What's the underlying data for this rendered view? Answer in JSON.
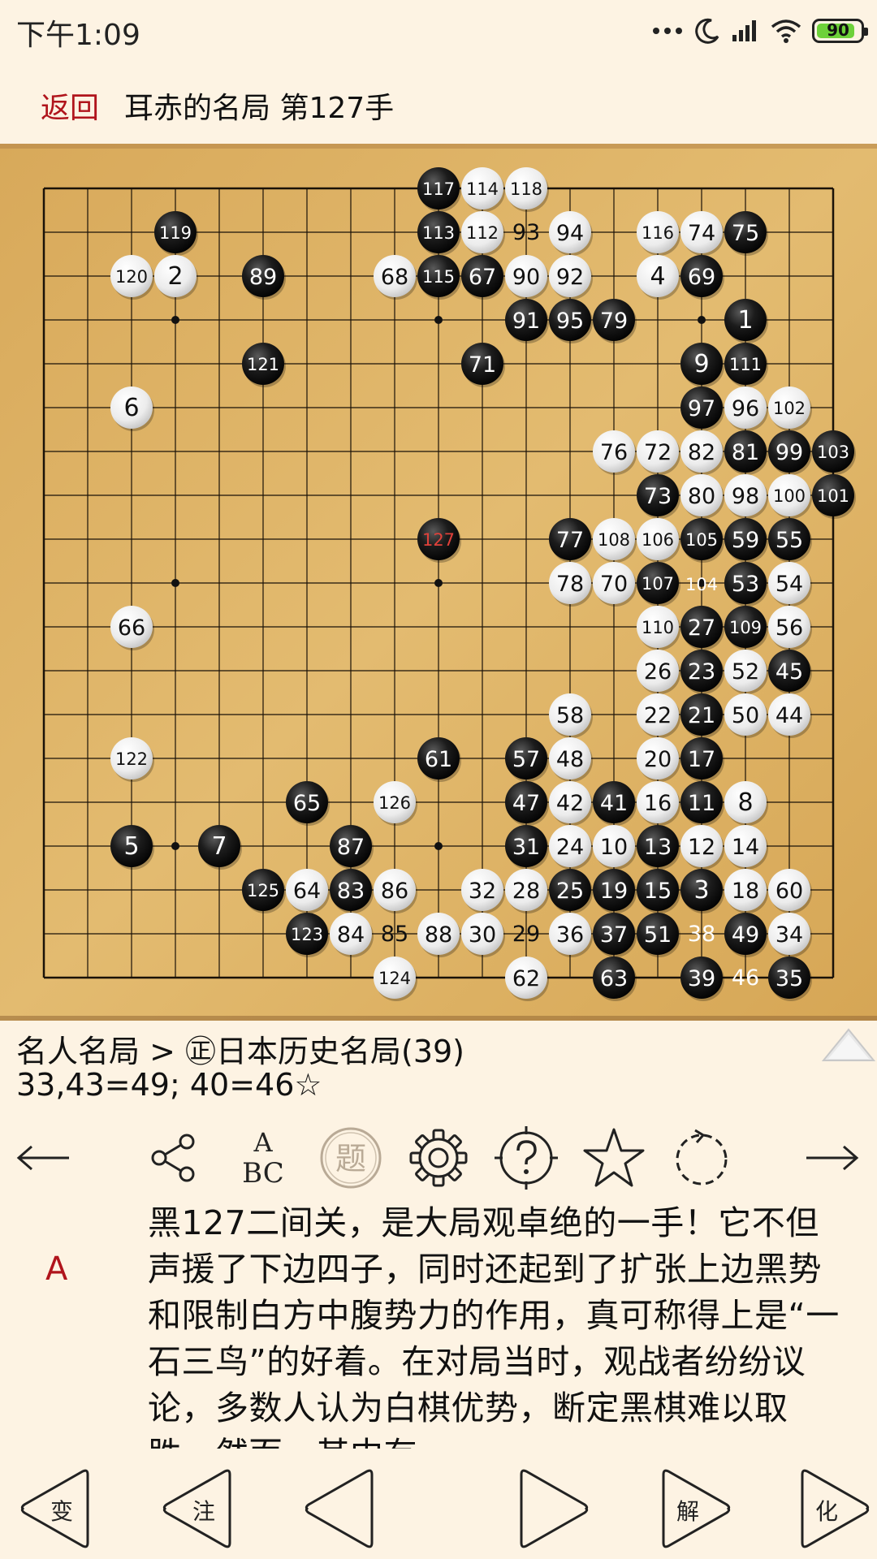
{
  "status_bar": {
    "time": "下午1:09",
    "battery": "90",
    "battery_level": 0.9
  },
  "header": {
    "back_label": "返回",
    "title": "耳赤的名局 第127手"
  },
  "board": {
    "size": 19,
    "hoshi": [
      [
        3,
        3
      ],
      [
        9,
        3
      ],
      [
        15,
        3
      ],
      [
        3,
        9
      ],
      [
        9,
        9
      ],
      [
        15,
        9
      ],
      [
        3,
        15
      ],
      [
        9,
        15
      ],
      [
        15,
        15
      ]
    ],
    "stones": [
      {
        "c": "b",
        "n": "117",
        "x": 9,
        "y": 0
      },
      {
        "c": "w",
        "n": "114",
        "x": 10,
        "y": 0
      },
      {
        "c": "w",
        "n": "118",
        "x": 11,
        "y": 0
      },
      {
        "c": "b",
        "n": "119",
        "x": 3,
        "y": 1
      },
      {
        "c": "b",
        "n": "113",
        "x": 9,
        "y": 1
      },
      {
        "c": "w",
        "n": "112",
        "x": 10,
        "y": 1
      },
      {
        "c": "w",
        "n": "94",
        "x": 12,
        "y": 1
      },
      {
        "c": "w",
        "n": "116",
        "x": 14,
        "y": 1
      },
      {
        "c": "w",
        "n": "74",
        "x": 15,
        "y": 1
      },
      {
        "c": "b",
        "n": "75",
        "x": 16,
        "y": 1
      },
      {
        "c": "w",
        "n": "120",
        "x": 2,
        "y": 2
      },
      {
        "c": "w",
        "n": "2",
        "x": 3,
        "y": 2
      },
      {
        "c": "b",
        "n": "89",
        "x": 5,
        "y": 2
      },
      {
        "c": "w",
        "n": "68",
        "x": 8,
        "y": 2
      },
      {
        "c": "b",
        "n": "115",
        "x": 9,
        "y": 2
      },
      {
        "c": "b",
        "n": "67",
        "x": 10,
        "y": 2
      },
      {
        "c": "w",
        "n": "90",
        "x": 11,
        "y": 2
      },
      {
        "c": "w",
        "n": "92",
        "x": 12,
        "y": 2
      },
      {
        "c": "w",
        "n": "4",
        "x": 14,
        "y": 2
      },
      {
        "c": "b",
        "n": "69",
        "x": 15,
        "y": 2
      },
      {
        "c": "b",
        "n": "91",
        "x": 11,
        "y": 3
      },
      {
        "c": "b",
        "n": "95",
        "x": 12,
        "y": 3
      },
      {
        "c": "b",
        "n": "79",
        "x": 13,
        "y": 3
      },
      {
        "c": "b",
        "n": "1",
        "x": 16,
        "y": 3
      },
      {
        "c": "b",
        "n": "121",
        "x": 5,
        "y": 4
      },
      {
        "c": "b",
        "n": "71",
        "x": 10,
        "y": 4
      },
      {
        "c": "b",
        "n": "9",
        "x": 15,
        "y": 4
      },
      {
        "c": "b",
        "n": "111",
        "x": 16,
        "y": 4
      },
      {
        "c": "w",
        "n": "6",
        "x": 2,
        "y": 5
      },
      {
        "c": "b",
        "n": "97",
        "x": 15,
        "y": 5
      },
      {
        "c": "w",
        "n": "96",
        "x": 16,
        "y": 5
      },
      {
        "c": "w",
        "n": "102",
        "x": 17,
        "y": 5
      },
      {
        "c": "w",
        "n": "76",
        "x": 13,
        "y": 6
      },
      {
        "c": "w",
        "n": "72",
        "x": 14,
        "y": 6
      },
      {
        "c": "w",
        "n": "82",
        "x": 15,
        "y": 6
      },
      {
        "c": "b",
        "n": "81",
        "x": 16,
        "y": 6
      },
      {
        "c": "b",
        "n": "99",
        "x": 17,
        "y": 6
      },
      {
        "c": "b",
        "n": "103",
        "x": 18,
        "y": 6
      },
      {
        "c": "b",
        "n": "73",
        "x": 14,
        "y": 7
      },
      {
        "c": "w",
        "n": "80",
        "x": 15,
        "y": 7
      },
      {
        "c": "w",
        "n": "98",
        "x": 16,
        "y": 7
      },
      {
        "c": "w",
        "n": "100",
        "x": 17,
        "y": 7
      },
      {
        "c": "b",
        "n": "101",
        "x": 18,
        "y": 7
      },
      {
        "c": "b",
        "n": "127",
        "x": 9,
        "y": 8,
        "last": true
      },
      {
        "c": "b",
        "n": "77",
        "x": 12,
        "y": 8
      },
      {
        "c": "w",
        "n": "108",
        "x": 13,
        "y": 8
      },
      {
        "c": "w",
        "n": "106",
        "x": 14,
        "y": 8
      },
      {
        "c": "b",
        "n": "105",
        "x": 15,
        "y": 8
      },
      {
        "c": "b",
        "n": "59",
        "x": 16,
        "y": 8
      },
      {
        "c": "b",
        "n": "55",
        "x": 17,
        "y": 8
      },
      {
        "c": "w",
        "n": "78",
        "x": 12,
        "y": 9
      },
      {
        "c": "w",
        "n": "70",
        "x": 13,
        "y": 9
      },
      {
        "c": "b",
        "n": "107",
        "x": 14,
        "y": 9
      },
      {
        "c": "b",
        "n": "53",
        "x": 16,
        "y": 9
      },
      {
        "c": "w",
        "n": "54",
        "x": 17,
        "y": 9
      },
      {
        "c": "w",
        "n": "66",
        "x": 2,
        "y": 10
      },
      {
        "c": "w",
        "n": "110",
        "x": 14,
        "y": 10
      },
      {
        "c": "b",
        "n": "27",
        "x": 15,
        "y": 10
      },
      {
        "c": "b",
        "n": "109",
        "x": 16,
        "y": 10
      },
      {
        "c": "w",
        "n": "56",
        "x": 17,
        "y": 10
      },
      {
        "c": "w",
        "n": "26",
        "x": 14,
        "y": 11
      },
      {
        "c": "b",
        "n": "23",
        "x": 15,
        "y": 11
      },
      {
        "c": "w",
        "n": "52",
        "x": 16,
        "y": 11
      },
      {
        "c": "b",
        "n": "45",
        "x": 17,
        "y": 11
      },
      {
        "c": "w",
        "n": "58",
        "x": 12,
        "y": 12
      },
      {
        "c": "w",
        "n": "22",
        "x": 14,
        "y": 12
      },
      {
        "c": "b",
        "n": "21",
        "x": 15,
        "y": 12
      },
      {
        "c": "w",
        "n": "50",
        "x": 16,
        "y": 12
      },
      {
        "c": "w",
        "n": "44",
        "x": 17,
        "y": 12
      },
      {
        "c": "w",
        "n": "122",
        "x": 2,
        "y": 13
      },
      {
        "c": "b",
        "n": "61",
        "x": 9,
        "y": 13
      },
      {
        "c": "b",
        "n": "57",
        "x": 11,
        "y": 13
      },
      {
        "c": "w",
        "n": "48",
        "x": 12,
        "y": 13
      },
      {
        "c": "w",
        "n": "20",
        "x": 14,
        "y": 13
      },
      {
        "c": "b",
        "n": "17",
        "x": 15,
        "y": 13
      },
      {
        "c": "b",
        "n": "65",
        "x": 6,
        "y": 14
      },
      {
        "c": "w",
        "n": "126",
        "x": 8,
        "y": 14
      },
      {
        "c": "b",
        "n": "47",
        "x": 11,
        "y": 14
      },
      {
        "c": "w",
        "n": "42",
        "x": 12,
        "y": 14
      },
      {
        "c": "b",
        "n": "41",
        "x": 13,
        "y": 14
      },
      {
        "c": "w",
        "n": "16",
        "x": 14,
        "y": 14
      },
      {
        "c": "b",
        "n": "11",
        "x": 15,
        "y": 14
      },
      {
        "c": "w",
        "n": "8",
        "x": 16,
        "y": 14
      },
      {
        "c": "b",
        "n": "5",
        "x": 2,
        "y": 15
      },
      {
        "c": "b",
        "n": "7",
        "x": 4,
        "y": 15
      },
      {
        "c": "b",
        "n": "87",
        "x": 7,
        "y": 15
      },
      {
        "c": "b",
        "n": "31",
        "x": 11,
        "y": 15
      },
      {
        "c": "w",
        "n": "24",
        "x": 12,
        "y": 15
      },
      {
        "c": "w",
        "n": "10",
        "x": 13,
        "y": 15
      },
      {
        "c": "b",
        "n": "13",
        "x": 14,
        "y": 15
      },
      {
        "c": "w",
        "n": "12",
        "x": 15,
        "y": 15
      },
      {
        "c": "w",
        "n": "14",
        "x": 16,
        "y": 15
      },
      {
        "c": "b",
        "n": "125",
        "x": 5,
        "y": 16
      },
      {
        "c": "w",
        "n": "64",
        "x": 6,
        "y": 16
      },
      {
        "c": "b",
        "n": "83",
        "x": 7,
        "y": 16
      },
      {
        "c": "w",
        "n": "86",
        "x": 8,
        "y": 16
      },
      {
        "c": "w",
        "n": "32",
        "x": 10,
        "y": 16
      },
      {
        "c": "w",
        "n": "28",
        "x": 11,
        "y": 16
      },
      {
        "c": "b",
        "n": "25",
        "x": 12,
        "y": 16
      },
      {
        "c": "b",
        "n": "19",
        "x": 13,
        "y": 16
      },
      {
        "c": "b",
        "n": "15",
        "x": 14,
        "y": 16
      },
      {
        "c": "b",
        "n": "3",
        "x": 15,
        "y": 16
      },
      {
        "c": "w",
        "n": "18",
        "x": 16,
        "y": 16
      },
      {
        "c": "w",
        "n": "60",
        "x": 17,
        "y": 16
      },
      {
        "c": "b",
        "n": "123",
        "x": 6,
        "y": 17
      },
      {
        "c": "w",
        "n": "84",
        "x": 7,
        "y": 17
      },
      {
        "c": "w",
        "n": "88",
        "x": 9,
        "y": 17
      },
      {
        "c": "w",
        "n": "30",
        "x": 10,
        "y": 17
      },
      {
        "c": "w",
        "n": "36",
        "x": 12,
        "y": 17
      },
      {
        "c": "b",
        "n": "37",
        "x": 13,
        "y": 17
      },
      {
        "c": "b",
        "n": "51",
        "x": 14,
        "y": 17
      },
      {
        "c": "b",
        "n": "49",
        "x": 16,
        "y": 17
      },
      {
        "c": "w",
        "n": "34",
        "x": 17,
        "y": 17
      },
      {
        "c": "w",
        "n": "124",
        "x": 8,
        "y": 18
      },
      {
        "c": "w",
        "n": "62",
        "x": 11,
        "y": 18
      },
      {
        "c": "b",
        "n": "63",
        "x": 13,
        "y": 18
      },
      {
        "c": "b",
        "n": "39",
        "x": 15,
        "y": 18
      },
      {
        "c": "b",
        "n": "35",
        "x": 17,
        "y": 18
      }
    ],
    "captured": [
      {
        "n": "93",
        "x": 11,
        "y": 1,
        "color": "#111111"
      },
      {
        "n": "104",
        "x": 15,
        "y": 9,
        "color": "#ffffff"
      },
      {
        "n": "85",
        "x": 8,
        "y": 17,
        "color": "#111111"
      },
      {
        "n": "29",
        "x": 11,
        "y": 17,
        "color": "#111111"
      },
      {
        "n": "38",
        "x": 15,
        "y": 17,
        "color": "#ffffff"
      },
      {
        "n": "46",
        "x": 16,
        "y": 18,
        "color": "#ffffff"
      }
    ],
    "last_move_color": "#e0413a"
  },
  "info": {
    "breadcrumb": "名人名局 > ㊣日本历史名局(39)",
    "notes": "33,43=49; 40=46☆"
  },
  "toolbar": {
    "prev_arrow": "←",
    "next_arrow": "→",
    "abc_top": "A",
    "abc_bottom": "BC",
    "topic_char": "题"
  },
  "commentary": {
    "marker": "A",
    "text": "黑127二间关，是大局观卓绝的一手！它不但声援了下边四子，同时还起到了扩张上边黑势和限制白方中腹势力的作用，真可称得上是“一石三鸟”的好着。在对局当时，观战者纷纷议论，多数人认为白棋优势，断定黑棋难以取胜。然而，其中有"
  },
  "bottom_nav": {
    "variation": "变",
    "annotate": "注",
    "solve": "解",
    "transform": "化"
  },
  "colors": {
    "accent": "#b0141c",
    "background": "#fdf3e3",
    "board": "#dcb064"
  }
}
